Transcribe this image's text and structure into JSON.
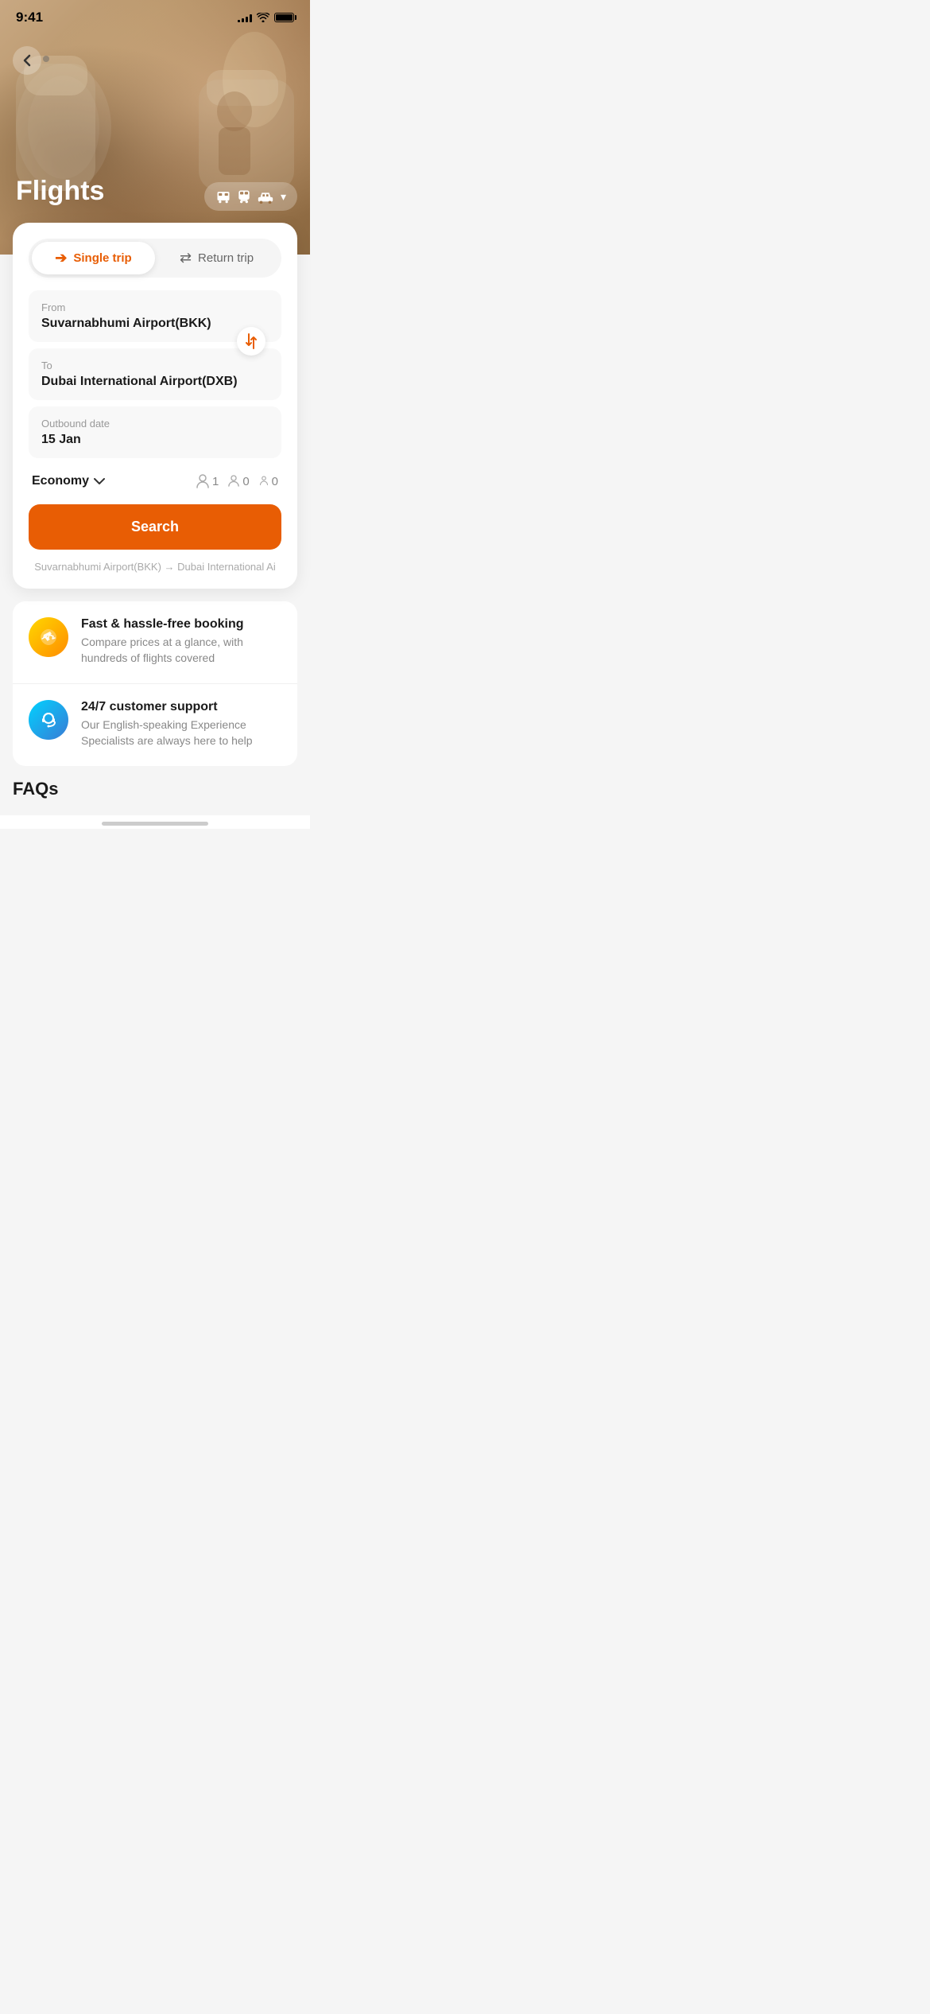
{
  "statusBar": {
    "time": "9:41",
    "signalBars": [
      4,
      6,
      8,
      10,
      12
    ],
    "battery": "full"
  },
  "hero": {
    "pageTitle": "Flights",
    "backButton": "‹",
    "transportIcons": [
      "🚌",
      "🚌",
      "🚗"
    ]
  },
  "tripToggle": {
    "singleTrip": {
      "label": "Single trip",
      "icon": "→",
      "active": true
    },
    "returnTrip": {
      "label": "Return trip",
      "icon": "↔",
      "active": false
    }
  },
  "form": {
    "from": {
      "label": "From",
      "value": "Suvarnabhumi Airport(BKK)"
    },
    "to": {
      "label": "To",
      "value": "Dubai International Airport(DXB)"
    },
    "outboundDate": {
      "label": "Outbound date",
      "value": "15 Jan"
    },
    "class": {
      "label": "Economy"
    },
    "passengers": {
      "adults": "1",
      "children": "0",
      "infants": "0"
    },
    "searchButton": "Search",
    "routeHint": "Suvarnabhumi Airport(BKK) → Dubai International Ai"
  },
  "features": [
    {
      "iconType": "orange",
      "iconEmoji": "✈",
      "title": "Fast & hassle-free booking",
      "description": "Compare prices at a glance, with hundreds of flights covered"
    },
    {
      "iconType": "blue",
      "iconEmoji": "🎧",
      "title": "24/7 customer support",
      "description": "Our English-speaking Experience Specialists are always here to help"
    }
  ],
  "faqs": {
    "title": "FAQs"
  },
  "colors": {
    "primary": "#e85d04",
    "textDark": "#1a1a1a",
    "textGray": "#888888",
    "bgLight": "#f8f8f8"
  }
}
